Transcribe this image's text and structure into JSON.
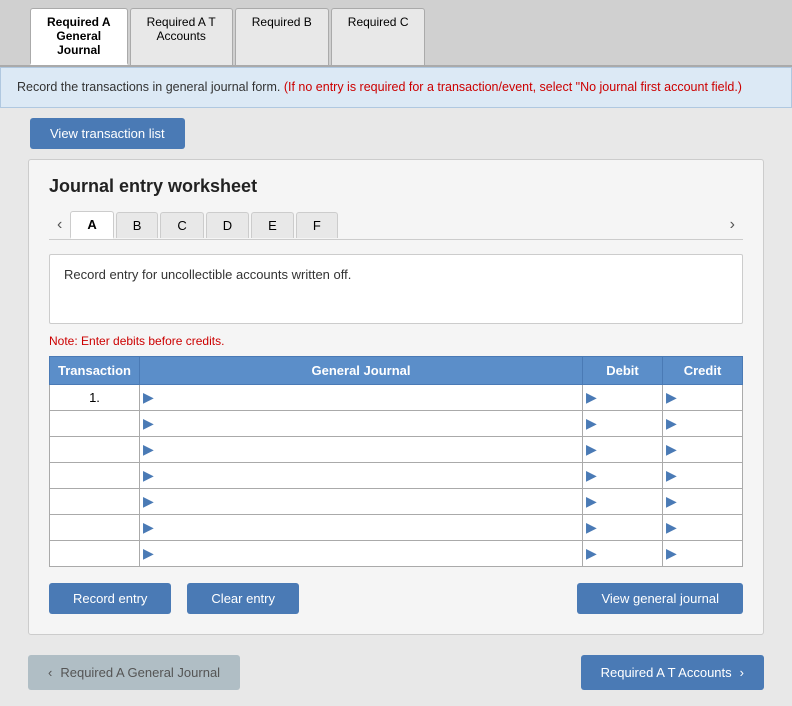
{
  "tabs": [
    {
      "id": "required-a-general-journal",
      "label": "Required A\nGeneral\nJournal",
      "active": true
    },
    {
      "id": "required-a-t-accounts",
      "label": "Required A T\nAccounts",
      "active": false
    },
    {
      "id": "required-b",
      "label": "Required B",
      "active": false
    },
    {
      "id": "required-c",
      "label": "Required C",
      "active": false
    }
  ],
  "info_banner": {
    "main_text": "Record the transactions in general journal form.",
    "red_text": "(If no entry is required for a transaction/event, select \"No journal\nfirst account field.)"
  },
  "view_transaction_btn": "View transaction list",
  "worksheet": {
    "title": "Journal entry worksheet",
    "letter_tabs": [
      "A",
      "B",
      "C",
      "D",
      "E",
      "F"
    ],
    "active_letter": "A",
    "description": "Record entry for uncollectible accounts written off.",
    "note": "Note: Enter debits before credits.",
    "table": {
      "headers": [
        "Transaction",
        "General Journal",
        "Debit",
        "Credit"
      ],
      "rows": [
        {
          "num": "1.",
          "journal": "",
          "debit": "",
          "credit": "",
          "stripe": false
        },
        {
          "num": "",
          "journal": "",
          "debit": "",
          "credit": "",
          "stripe": true
        },
        {
          "num": "",
          "journal": "",
          "debit": "",
          "credit": "",
          "stripe": false
        },
        {
          "num": "",
          "journal": "",
          "debit": "",
          "credit": "",
          "stripe": true
        },
        {
          "num": "",
          "journal": "",
          "debit": "",
          "credit": "",
          "stripe": false
        },
        {
          "num": "",
          "journal": "",
          "debit": "",
          "credit": "",
          "stripe": true
        },
        {
          "num": "",
          "journal": "",
          "debit": "",
          "credit": "",
          "stripe": false
        }
      ]
    },
    "buttons": {
      "record": "Record entry",
      "clear": "Clear entry",
      "view_general": "View general journal"
    }
  },
  "bottom_nav": {
    "prev_label": "Required A General Journal",
    "next_label": "Required A T Accounts"
  }
}
